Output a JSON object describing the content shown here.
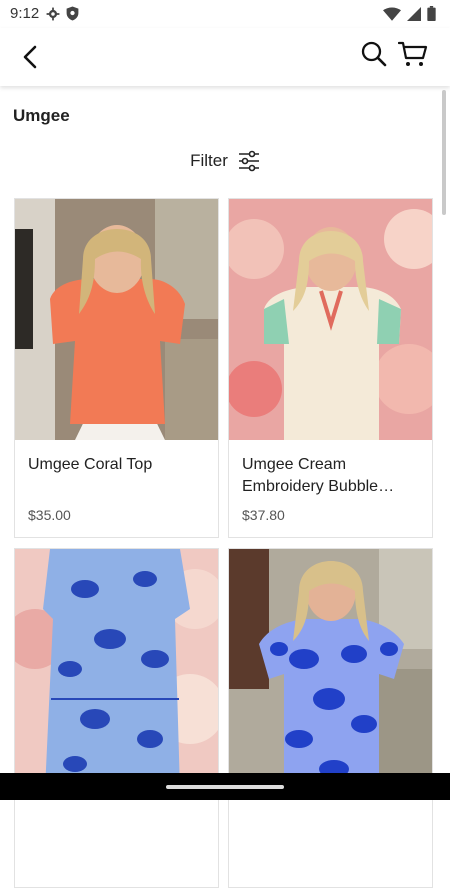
{
  "status": {
    "time": "9:12"
  },
  "header": {
    "back": "back",
    "search": "search",
    "cart": "cart"
  },
  "brand": {
    "title": "Umgee"
  },
  "filter": {
    "label": "Filter"
  },
  "products": [
    {
      "name": "Umgee Coral Top",
      "price": "$35.00"
    },
    {
      "name": "Umgee Cream Embroidery Bubble Sleeve Top",
      "price": "$37.80"
    },
    {
      "name": "",
      "price": ""
    },
    {
      "name": "",
      "price": ""
    }
  ],
  "colors": {
    "coral": "#f27a55",
    "cream": "#f4ead8",
    "blue": "#2848b8",
    "lightblue": "#8fb0e6"
  }
}
